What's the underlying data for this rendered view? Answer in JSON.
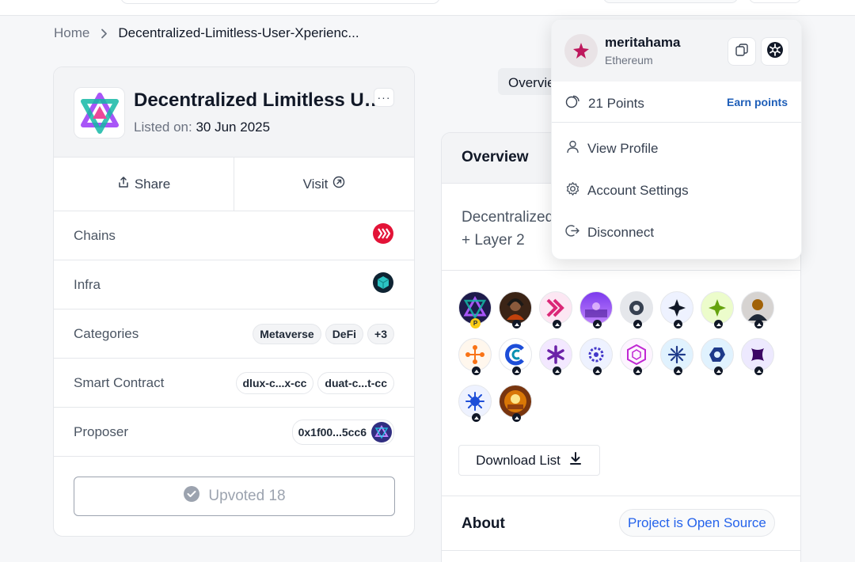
{
  "breadcrumb": {
    "home": "Home",
    "current": "Decentralized-Limitless-User-Xperienc..."
  },
  "project": {
    "title": "Decentralized Limitless User Xperience",
    "listed_label": "Listed on:",
    "listed_date": "30 Jun 2025",
    "more_label": "···",
    "share_label": "Share",
    "visit_label": "Visit"
  },
  "details": {
    "chains_label": "Chains",
    "infra_label": "Infra",
    "categories_label": "Categories",
    "categories": [
      "Metaverse",
      "DeFi",
      "+3"
    ],
    "contract_label": "Smart Contract",
    "contracts": [
      "dlux-c...x-cc",
      "duat-c...t-cc"
    ],
    "proposer_label": "Proposer",
    "proposer": "0x1f00...5cc6"
  },
  "upvote_label": "Upvoted 18",
  "tab_label": "Overview",
  "overview": {
    "title": "Overview",
    "description_line1": "Decentralized",
    "description_line2": "+ Layer 2",
    "download_label": "Download List",
    "about_title": "About",
    "open_source_label": "Project is Open Source"
  },
  "user_menu": {
    "username": "meritahama",
    "chain": "Ethereum",
    "points": "21 Points",
    "earn_label": "Earn points",
    "view_profile": "View Profile",
    "account_settings": "Account Settings",
    "disconnect": "Disconnect"
  },
  "colors": {
    "accent_blue": "#1e5eb8",
    "brand_red": "#e11d48",
    "muted": "#6b7280"
  }
}
